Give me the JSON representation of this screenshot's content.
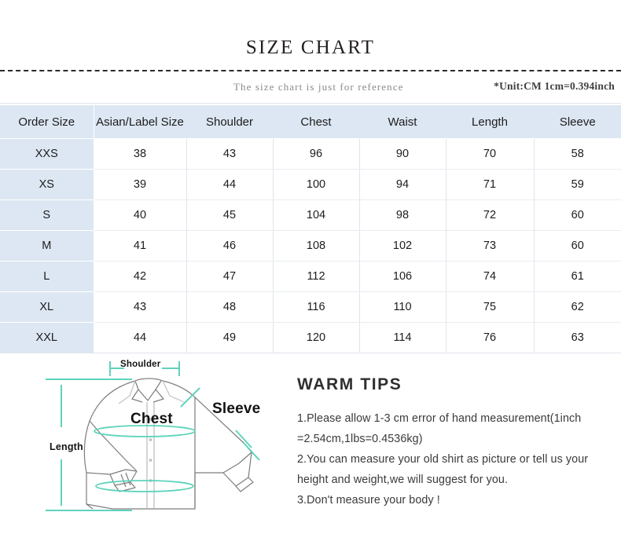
{
  "header": {
    "title": "SIZE CHART",
    "subtitle": "The size chart is just for reference",
    "unit_note": "*Unit:CM 1cm=0.394inch"
  },
  "table": {
    "columns": [
      "Order Size",
      "Asian/Label Size",
      "Shoulder",
      "Chest",
      "Waist",
      "Length",
      "Sleeve"
    ],
    "rows": [
      {
        "order_size": "XXS",
        "asian_label_size": "38",
        "shoulder": "43",
        "chest": "96",
        "waist": "90",
        "length": "70",
        "sleeve": "58"
      },
      {
        "order_size": "XS",
        "asian_label_size": "39",
        "shoulder": "44",
        "chest": "100",
        "waist": "94",
        "length": "71",
        "sleeve": "59"
      },
      {
        "order_size": "S",
        "asian_label_size": "40",
        "shoulder": "45",
        "chest": "104",
        "waist": "98",
        "length": "72",
        "sleeve": "60"
      },
      {
        "order_size": "M",
        "asian_label_size": "41",
        "shoulder": "46",
        "chest": "108",
        "waist": "102",
        "length": "73",
        "sleeve": "60"
      },
      {
        "order_size": "L",
        "asian_label_size": "42",
        "shoulder": "47",
        "chest": "112",
        "waist": "106",
        "length": "74",
        "sleeve": "61"
      },
      {
        "order_size": "XL",
        "asian_label_size": "43",
        "shoulder": "48",
        "chest": "116",
        "waist": "110",
        "length": "75",
        "sleeve": "62"
      },
      {
        "order_size": "XXL",
        "asian_label_size": "44",
        "shoulder": "49",
        "chest": "120",
        "waist": "114",
        "length": "76",
        "sleeve": "63"
      }
    ]
  },
  "diagram": {
    "labels": {
      "shoulder": "Shoulder",
      "chest": "Chest",
      "sleeve": "Sleeve",
      "length": "Length"
    },
    "measure_color": "#5fd3bc",
    "outline_color": "#7d7d7d"
  },
  "tips": {
    "title": "WARM TIPS",
    "lines": [
      "1.Please allow 1-3 cm error of hand measurement(1inch",
      "=2.54cm,1lbs=0.4536kg)",
      "2.You can measure your old shirt as picture or tell us your",
      "height and weight,we will suggest for you.",
      "3.Don't measure your body !"
    ]
  },
  "colors": {
    "header_cell_bg": "#dde7f3",
    "first_column_bg": "#dde7f3",
    "cell_border": "#dfe4ea",
    "title_color": "#231f20"
  }
}
